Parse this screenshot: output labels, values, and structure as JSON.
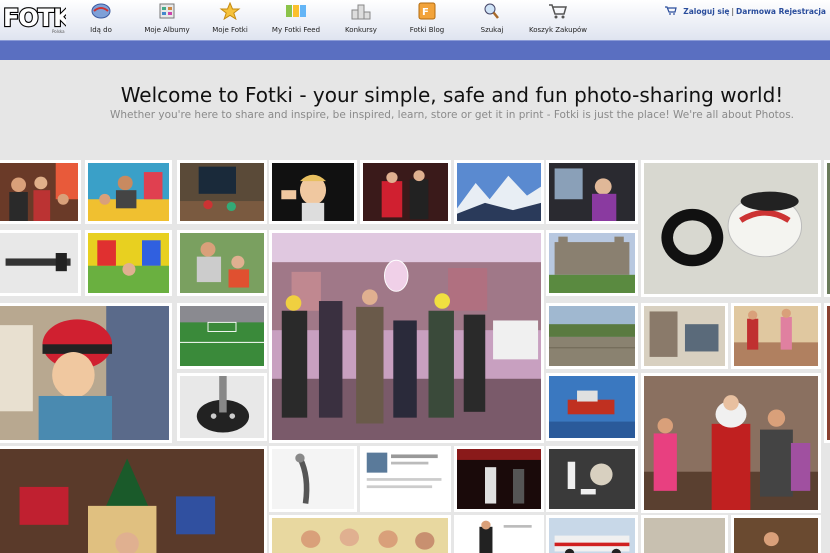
{
  "brand": {
    "logo_text": "FOTKI",
    "logo_tag": "Polska"
  },
  "nav": [
    {
      "label": "Idą do",
      "icon": "globe-icon"
    },
    {
      "label": "Moje Albumy",
      "icon": "album-icon"
    },
    {
      "label": "Moje Fotki",
      "icon": "star-icon"
    },
    {
      "label": "My Fotki Feed",
      "icon": "feed-icon"
    },
    {
      "label": "Konkursy",
      "icon": "podium-icon"
    },
    {
      "label": "Fotki Blog",
      "icon": "blog-icon"
    },
    {
      "label": "Szukaj",
      "icon": "magnifier-icon"
    },
    {
      "label": "Koszyk Zakupów",
      "icon": "cart-icon"
    }
  ],
  "auth": {
    "login": "Zaloguj się",
    "separator": "|",
    "register": "Darmowa Rejestracja"
  },
  "welcome": {
    "title": "Welcome to Fotki - your simple, safe and fun photo-sharing world!",
    "subtitle": "Whether you're here to share and inspire, be inspired, learn, store or get it in print - Fotki is just the place! We're all about Photos."
  },
  "colors": {
    "nav_blue": "#5a6fc1",
    "link_blue": "#2a4d9c",
    "page_bg": "#e6e6e6"
  },
  "photos": [
    "family-group-photo",
    "kids-playing-photo",
    "living-room-photo",
    "laughing-child-photo",
    "dancers-photo",
    "mountain-landscape-photo",
    "child-car-seat-photo",
    "rubber-gaskets-photo",
    "pipe-tool-photo",
    "bouncy-castle-photo",
    "woman-sitting-photo",
    "carnival-parade-photo",
    "stone-castle-photo",
    "boy-helmet-photo",
    "football-stadium-photo",
    "stone-wall-photo",
    "office-interior-photo",
    "party-room-photo",
    "metal-part-photo",
    "boat-harbor-photo",
    "christmas-family-photo",
    "christmas-gifts-photo",
    "dancer-pose-photo",
    "social-post-photo",
    "stage-performance-photo",
    "small-objects-photo",
    "race-car-photo",
    "group-men-photo",
    "fashion-model-photo",
    "product-page-photo",
    "ceremony-photo",
    "wooden-room-photo",
    "red-building-photo",
    "building-edge-photo"
  ]
}
